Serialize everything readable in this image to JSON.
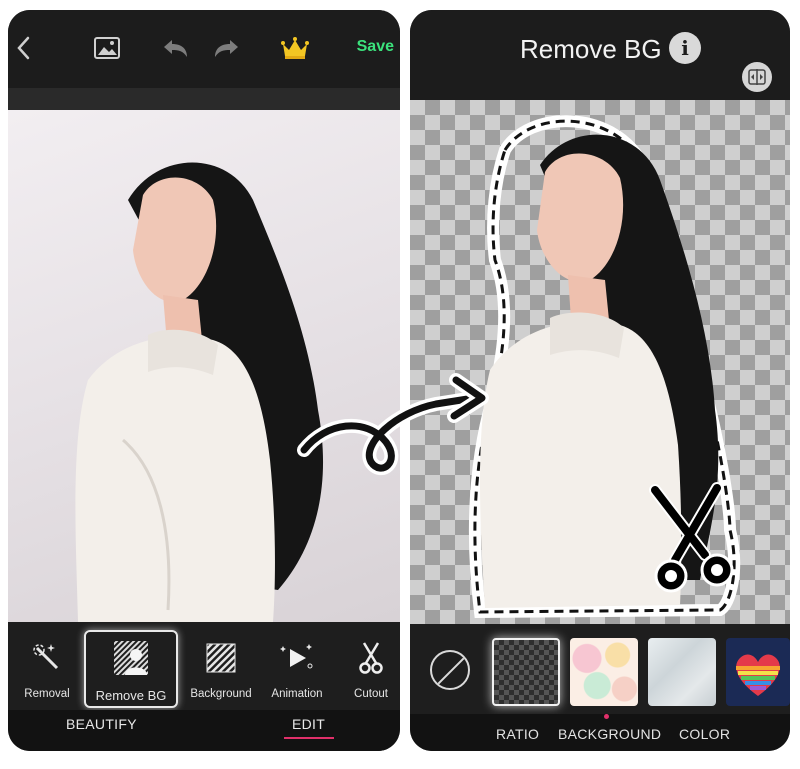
{
  "left_phone": {
    "toolbar": {
      "save_label": "Save"
    },
    "tools": [
      {
        "label": "Removal",
        "icon": "magic-wand-icon"
      },
      {
        "label": "Remove BG",
        "icon": "remove-bg-icon",
        "active": true
      },
      {
        "label": "Background",
        "icon": "striped-square-icon"
      },
      {
        "label": "Animation",
        "icon": "play-sparkle-icon"
      },
      {
        "label": "Cutout",
        "icon": "scissors-icon"
      }
    ],
    "tabs": [
      {
        "label": "BEAUTIFY"
      },
      {
        "label": "EDIT",
        "active": true
      }
    ]
  },
  "right_phone": {
    "title": "Remove BG",
    "bottom_tabs": [
      {
        "label": "RATIO"
      },
      {
        "label": "BACKGROUND",
        "active": true
      },
      {
        "label": "COLOR"
      }
    ],
    "backgrounds": [
      "transparent",
      "pastel-camo",
      "light-texture",
      "rainbow-heart"
    ]
  },
  "colors": {
    "accent": "#3be27c",
    "tab_indicator": "#e0306a",
    "dark_bg": "#1a1a1a"
  }
}
